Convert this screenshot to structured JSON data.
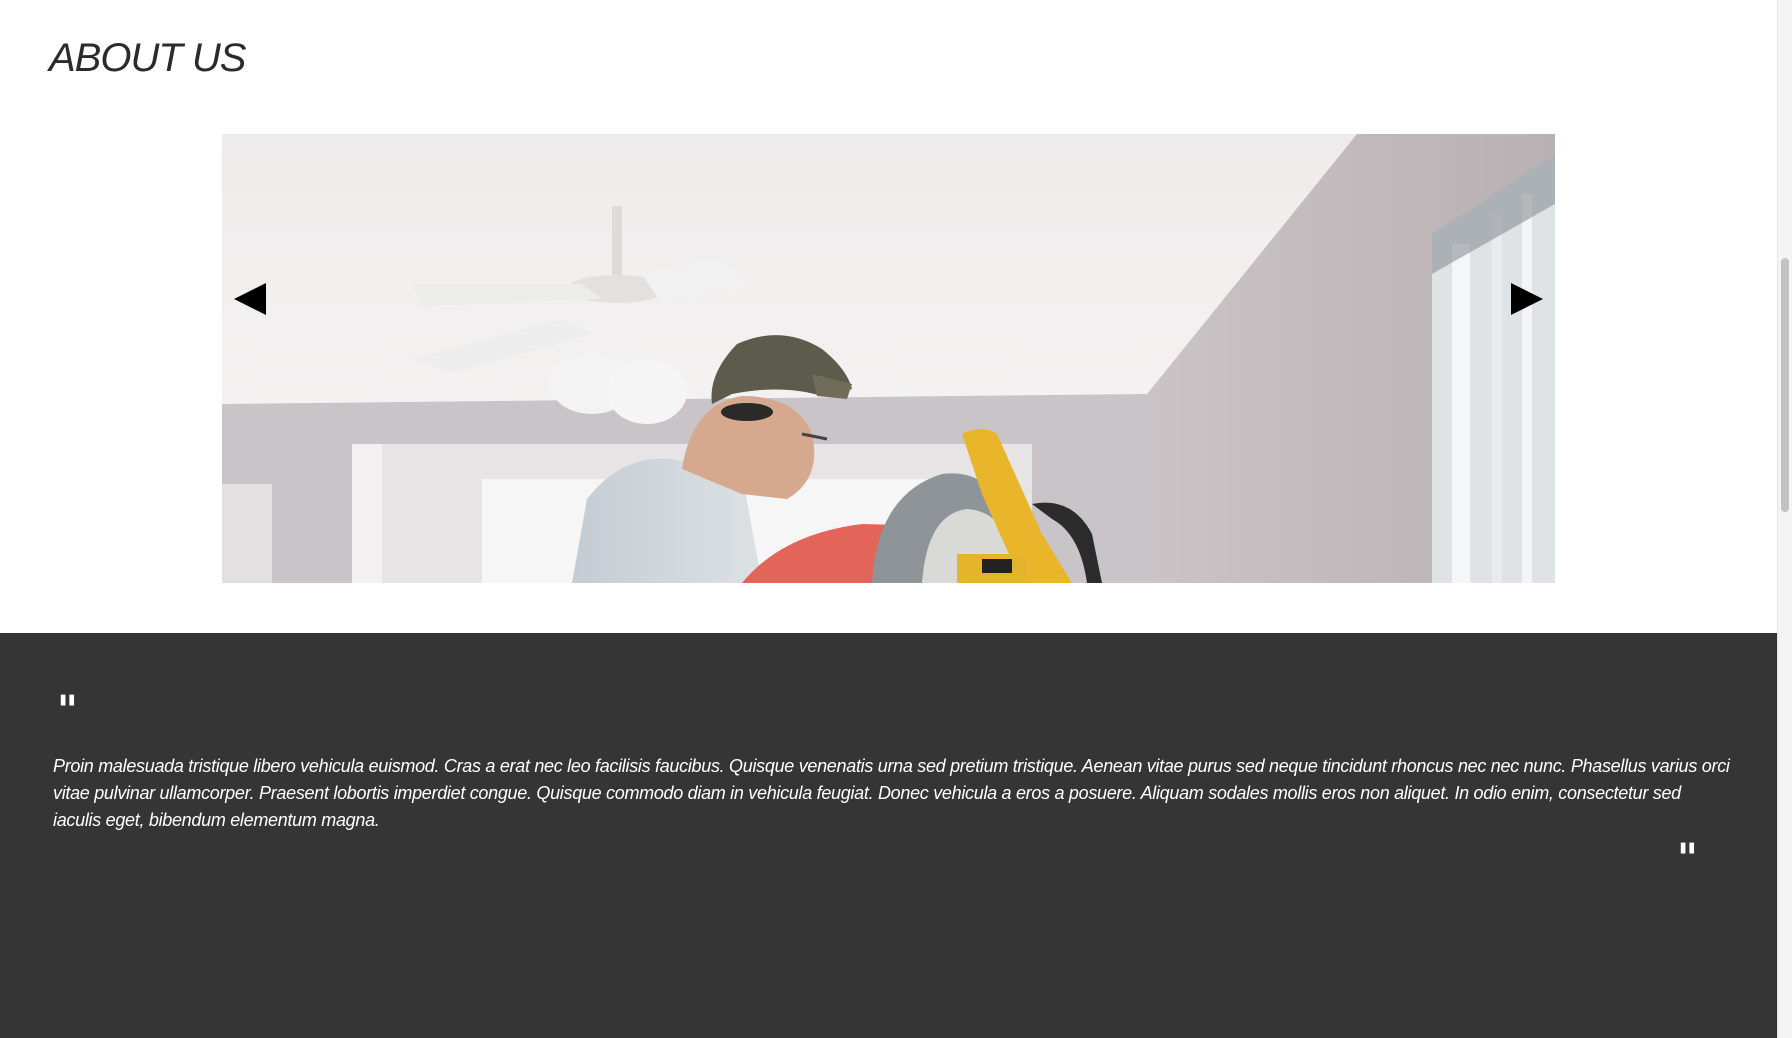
{
  "section": {
    "title": "ABOUT US"
  },
  "slider": {
    "image": "carpenter-with-miter-saw-photo",
    "prev_icon": "triangle-left-icon",
    "next_icon": "triangle-right-icon"
  },
  "testimonial": {
    "open_quote": "\"",
    "text": "Proin malesuada tristique libero vehicula euismod. Cras a erat nec leo facilisis faucibus. Quisque venenatis urna sed pretium tristique. Aenean vitae purus sed neque tincidunt rhoncus nec nec nunc. Phasellus varius orci vitae pulvinar ullamcorper. Praesent lobortis imperdiet congue. Quisque commodo diam in vehicula feugiat. Donec vehicula a eros a posuere. Aliquam sodales mollis eros non aliquet. In odio enim, consectetur sed iaculis eget, bibendum elementum magna.",
    "close_quote": "\""
  },
  "colors": {
    "background": "#ffffff",
    "quote_background": "#353535",
    "quote_text": "#ffffff",
    "title": "#2b2b2b"
  }
}
